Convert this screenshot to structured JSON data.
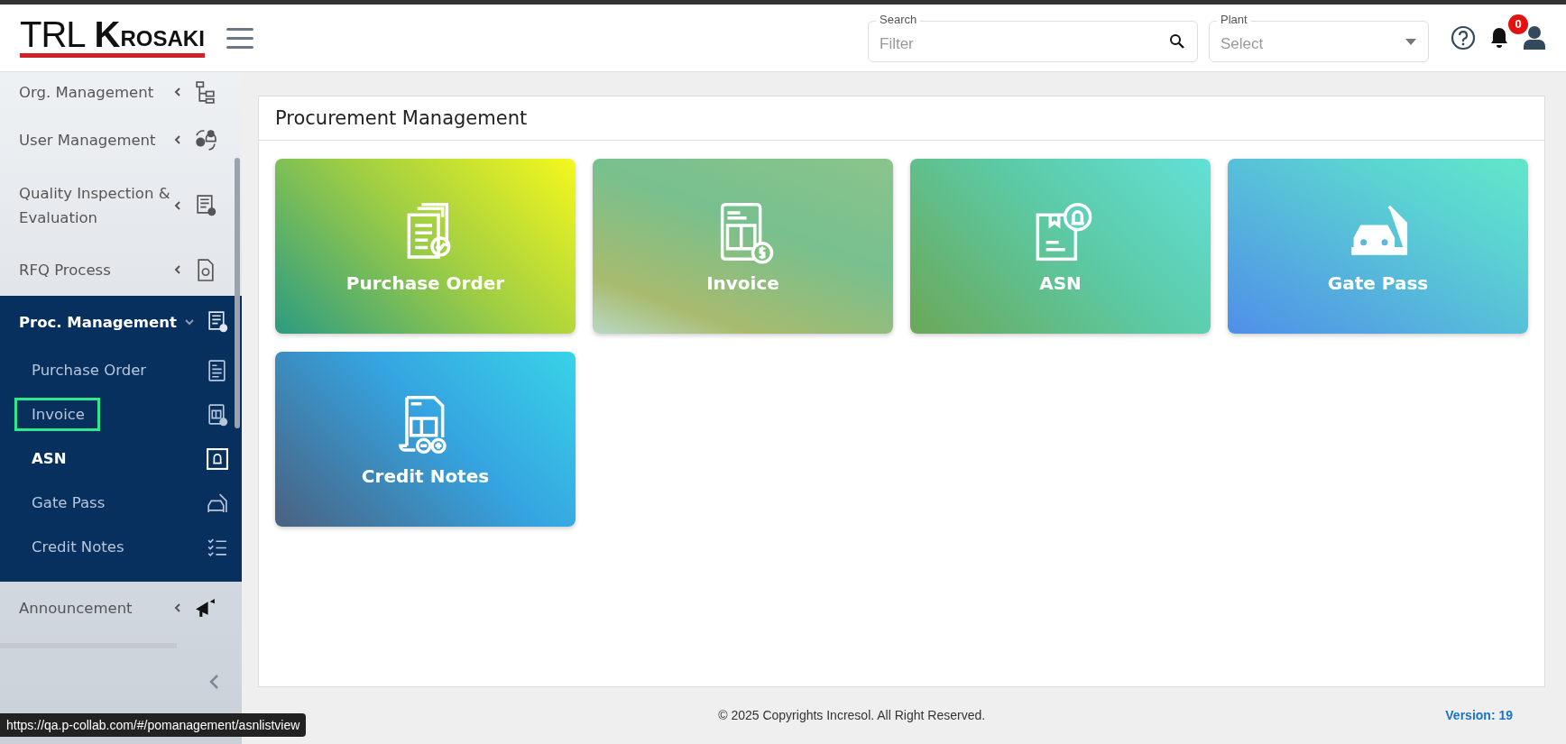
{
  "header": {
    "logo": {
      "left": "TRL",
      "mark": "K",
      "right": "ROSAKI"
    },
    "search": {
      "label": "Search",
      "placeholder": "Filter"
    },
    "plant": {
      "label": "Plant",
      "placeholder": "Select"
    },
    "notifications": {
      "count": "0"
    }
  },
  "sidebar": {
    "items": [
      {
        "label": "Org. Management",
        "kind": "org",
        "expanded": false
      },
      {
        "label": "User Management",
        "kind": "users",
        "expanded": false
      },
      {
        "label": "Quality Inspection & Evaluation",
        "kind": "quality",
        "expanded": false
      },
      {
        "label": "RFQ Process",
        "kind": "rfq",
        "expanded": false
      },
      {
        "label": "Proc. Management",
        "kind": "proc",
        "expanded": true,
        "children": [
          {
            "label": "Purchase Order",
            "kind": "po",
            "selected": false,
            "highlighted": false
          },
          {
            "label": "Invoice",
            "kind": "invoice",
            "selected": false,
            "highlighted": true
          },
          {
            "label": "ASN",
            "kind": "asn",
            "selected": true,
            "highlighted": false
          },
          {
            "label": "Gate Pass",
            "kind": "gate",
            "selected": false,
            "highlighted": false
          },
          {
            "label": "Credit Notes",
            "kind": "credit",
            "selected": false,
            "highlighted": false
          }
        ]
      },
      {
        "label": "Announcement",
        "kind": "announce",
        "expanded": false
      }
    ]
  },
  "panel": {
    "title": "Procurement Management",
    "cards": [
      {
        "label": "Purchase Order",
        "kind": "po"
      },
      {
        "label": "Invoice",
        "kind": "invoice"
      },
      {
        "label": "ASN",
        "kind": "asn"
      },
      {
        "label": "Gate Pass",
        "kind": "gate"
      },
      {
        "label": "Credit Notes",
        "kind": "credit"
      }
    ]
  },
  "footer": {
    "copyright": "© 2025 Copyrights Incresol. All Right Reserved.",
    "version": "Version: 19"
  },
  "status_bar": {
    "url": "https://qa.p-collab.com/#/pomanagement/asnlistview"
  }
}
